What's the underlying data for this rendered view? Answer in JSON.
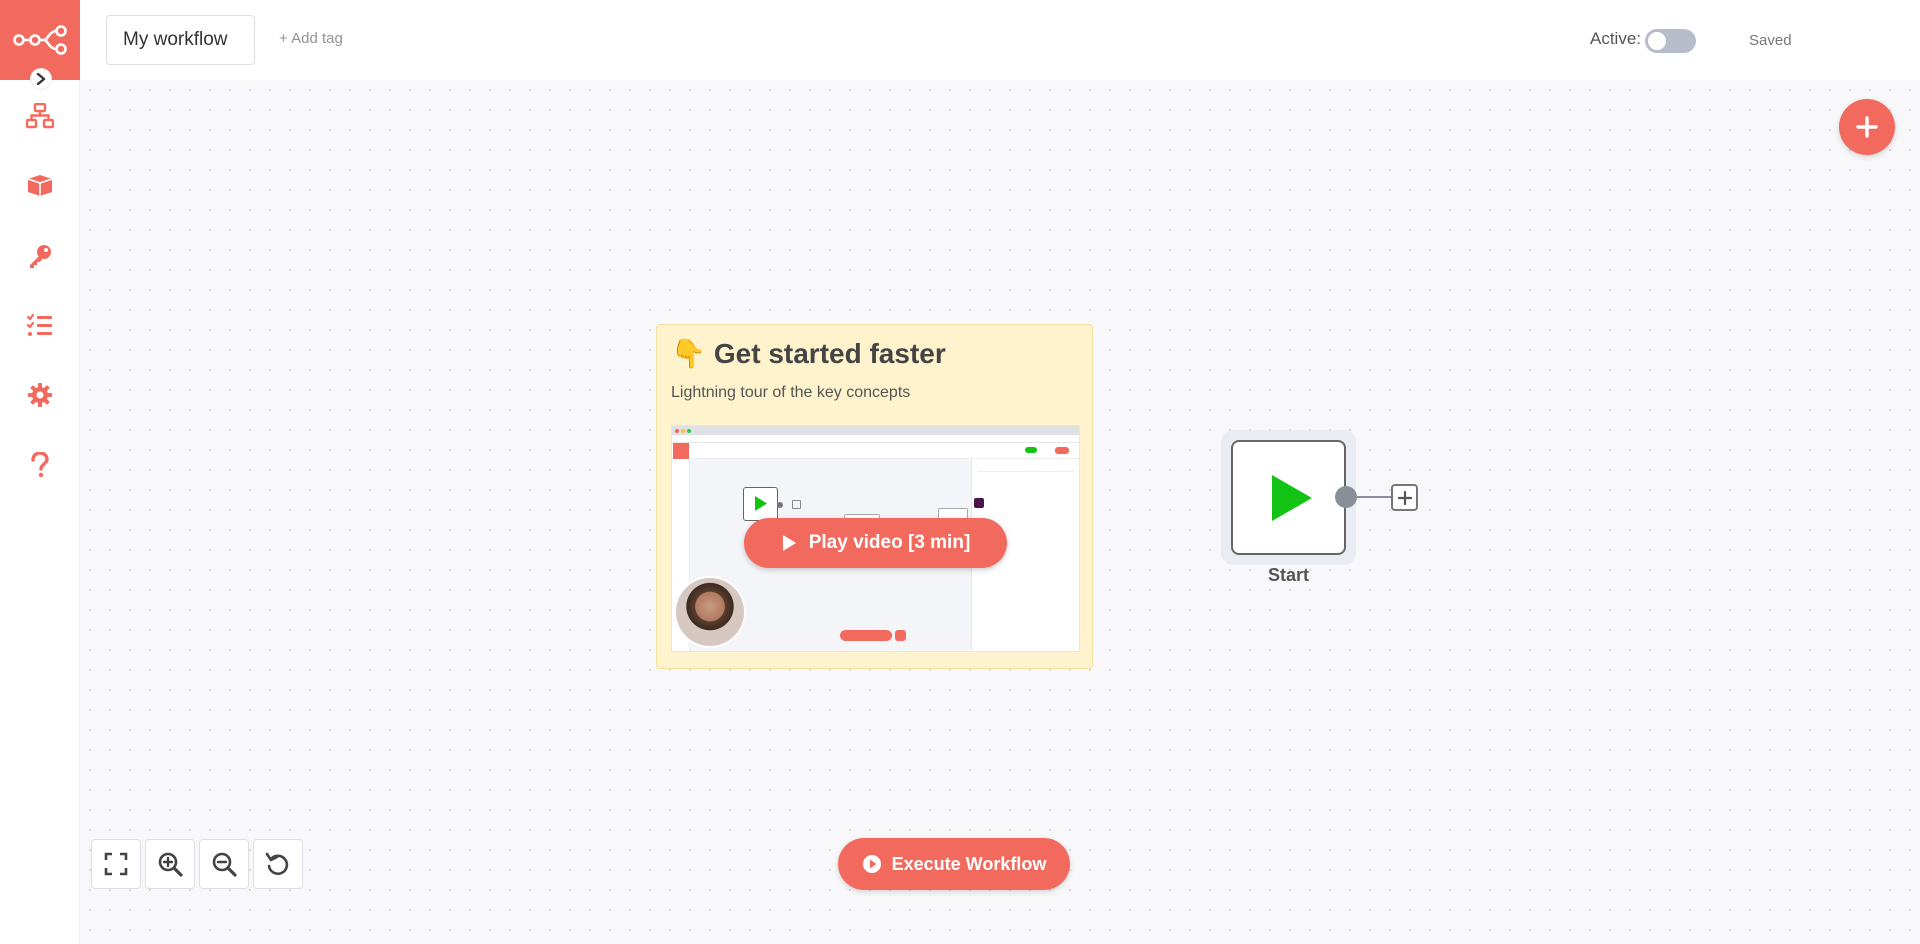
{
  "header": {
    "workflow_name": "My workflow",
    "add_tag_label": "+ Add tag",
    "active_label": "Active:",
    "active_state": false,
    "save_status": "Saved"
  },
  "sidebar": {
    "items": [
      {
        "icon": "network-icon",
        "label": "Workflows"
      },
      {
        "icon": "box-open-icon",
        "label": "Templates"
      },
      {
        "icon": "key-icon",
        "label": "Credentials"
      },
      {
        "icon": "tasks-icon",
        "label": "Executions"
      },
      {
        "icon": "gear-icon",
        "label": "Settings"
      },
      {
        "icon": "question-icon",
        "label": "Help"
      }
    ]
  },
  "sticky_note": {
    "emoji": "👇",
    "title": "Get started faster",
    "subtitle": "Lightning tour of the key concepts",
    "play_button_label": "Play video [3 min]"
  },
  "start_node": {
    "label": "Start"
  },
  "footer": {
    "execute_button_label": "Execute Workflow"
  },
  "colors": {
    "brand": "#f26a5e",
    "play_green": "#13c313"
  }
}
